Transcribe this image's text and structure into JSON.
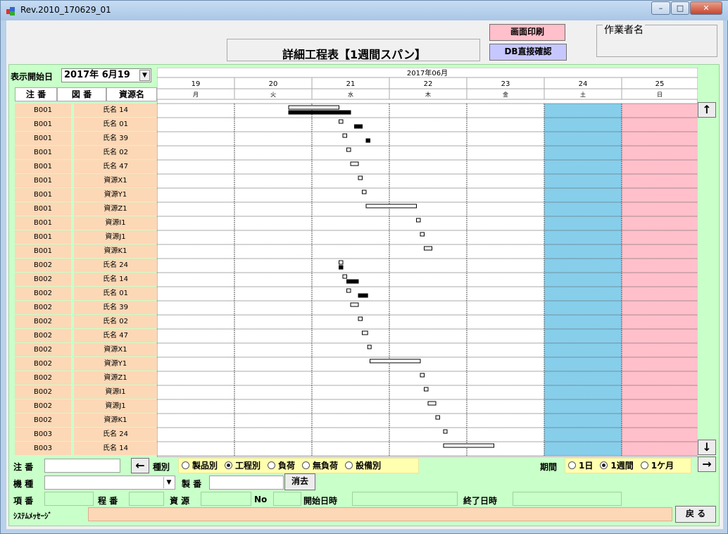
{
  "window": {
    "title": "Rev.2010_170629_01"
  },
  "header": {
    "title": "詳細工程表【1週間スパン】",
    "print_button": "画面印刷",
    "db_button": "DB直接確認",
    "worker_label": "作業者名"
  },
  "filter": {
    "start_label": "表示開始日",
    "start_value": "2017年  6月19"
  },
  "columns": {
    "order": "注 番",
    "drawing": "図 番",
    "resource": "資源名"
  },
  "calendar": {
    "month": "2017年06月",
    "days": [
      "19",
      "20",
      "21",
      "22",
      "23",
      "24",
      "25"
    ],
    "weekdays": [
      "月",
      "火",
      "水",
      "木",
      "金",
      "土",
      "日"
    ],
    "colors": {
      "saturday": "#87ceeb",
      "sunday": "#ffc0cb"
    }
  },
  "rows": [
    {
      "order": "B001",
      "resource": "氏名 14"
    },
    {
      "order": "B001",
      "resource": "氏名 01"
    },
    {
      "order": "B001",
      "resource": "氏名 39"
    },
    {
      "order": "B001",
      "resource": "氏名 02"
    },
    {
      "order": "B001",
      "resource": "氏名 47"
    },
    {
      "order": "B001",
      "resource": "資源X1"
    },
    {
      "order": "B001",
      "resource": "資源Y1"
    },
    {
      "order": "B001",
      "resource": "資源Z1"
    },
    {
      "order": "B001",
      "resource": "資源I1"
    },
    {
      "order": "B001",
      "resource": "資源J1"
    },
    {
      "order": "B001",
      "resource": "資源K1"
    },
    {
      "order": "B002",
      "resource": "氏名 24"
    },
    {
      "order": "B002",
      "resource": "氏名 14"
    },
    {
      "order": "B002",
      "resource": "氏名 01"
    },
    {
      "order": "B002",
      "resource": "氏名 39"
    },
    {
      "order": "B002",
      "resource": "氏名 02"
    },
    {
      "order": "B002",
      "resource": "氏名 47"
    },
    {
      "order": "B002",
      "resource": "資源X1"
    },
    {
      "order": "B002",
      "resource": "資源Y1"
    },
    {
      "order": "B002",
      "resource": "資源Z1"
    },
    {
      "order": "B002",
      "resource": "資源I1"
    },
    {
      "order": "B002",
      "resource": "資源J1"
    },
    {
      "order": "B002",
      "resource": "資源K1"
    },
    {
      "order": "B003",
      "resource": "氏名 24"
    },
    {
      "order": "B003",
      "resource": "氏名 14"
    }
  ],
  "bars": [
    {
      "row": 0,
      "start": 20.7,
      "end": 21.35,
      "filled": false
    },
    {
      "row": 0,
      "start": 20.7,
      "end": 21.5,
      "filled": true
    },
    {
      "row": 1,
      "start": 21.35,
      "end": 21.4,
      "filled": false
    },
    {
      "row": 1,
      "start": 21.55,
      "end": 21.65,
      "filled": true
    },
    {
      "row": 2,
      "start": 21.4,
      "end": 21.45,
      "filled": false
    },
    {
      "row": 2,
      "start": 21.7,
      "end": 21.75,
      "filled": true
    },
    {
      "row": 3,
      "start": 21.45,
      "end": 21.5,
      "filled": false
    },
    {
      "row": 4,
      "start": 21.5,
      "end": 21.6,
      "filled": false
    },
    {
      "row": 5,
      "start": 21.6,
      "end": 21.65,
      "filled": false
    },
    {
      "row": 6,
      "start": 21.65,
      "end": 21.7,
      "filled": false
    },
    {
      "row": 7,
      "start": 21.7,
      "end": 22.35,
      "filled": false
    },
    {
      "row": 8,
      "start": 22.35,
      "end": 22.4,
      "filled": false
    },
    {
      "row": 9,
      "start": 22.4,
      "end": 22.45,
      "filled": false
    },
    {
      "row": 10,
      "start": 22.45,
      "end": 22.55,
      "filled": false
    },
    {
      "row": 11,
      "start": 21.35,
      "end": 21.4,
      "filled": false
    },
    {
      "row": 11,
      "start": 21.35,
      "end": 21.4,
      "filled": true
    },
    {
      "row": 12,
      "start": 21.4,
      "end": 21.45,
      "filled": false
    },
    {
      "row": 12,
      "start": 21.45,
      "end": 21.6,
      "filled": true
    },
    {
      "row": 13,
      "start": 21.45,
      "end": 21.5,
      "filled": false
    },
    {
      "row": 13,
      "start": 21.6,
      "end": 21.72,
      "filled": true
    },
    {
      "row": 14,
      "start": 21.5,
      "end": 21.6,
      "filled": false
    },
    {
      "row": 15,
      "start": 21.6,
      "end": 21.65,
      "filled": false
    },
    {
      "row": 16,
      "start": 21.65,
      "end": 21.72,
      "filled": false
    },
    {
      "row": 17,
      "start": 21.72,
      "end": 21.76,
      "filled": false
    },
    {
      "row": 18,
      "start": 21.75,
      "end": 22.4,
      "filled": false
    },
    {
      "row": 19,
      "start": 22.4,
      "end": 22.45,
      "filled": false
    },
    {
      "row": 20,
      "start": 22.45,
      "end": 22.5,
      "filled": false
    },
    {
      "row": 21,
      "start": 22.5,
      "end": 22.6,
      "filled": false
    },
    {
      "row": 22,
      "start": 22.6,
      "end": 22.65,
      "filled": false
    },
    {
      "row": 23,
      "start": 22.7,
      "end": 22.73,
      "filled": false
    },
    {
      "row": 24,
      "start": 22.7,
      "end": 23.35,
      "filled": false
    }
  ],
  "bottom": {
    "order_label": "注 番",
    "type_label": "種別",
    "type_options": [
      "製品別",
      "工程別",
      "負荷",
      "無負荷",
      "設備別"
    ],
    "type_selected": 1,
    "period_label": "期間",
    "period_options": [
      "1日",
      "1週間",
      "1ケ月"
    ],
    "period_selected": 1,
    "model_label": "機 種",
    "serial_label": "製 番",
    "clear_button": "消去",
    "item_label": "項 番",
    "process_label": "程 番",
    "resource_label": "資 源",
    "no_label": "No",
    "start_label": "開始日時",
    "end_label": "終了日時",
    "message_label": "ｼｽﾃﾑﾒｯｾｰｼﾞ",
    "back_button": "戻 る"
  },
  "icons": {
    "up": "↑",
    "down": "↓",
    "left": "←",
    "right": "→"
  }
}
